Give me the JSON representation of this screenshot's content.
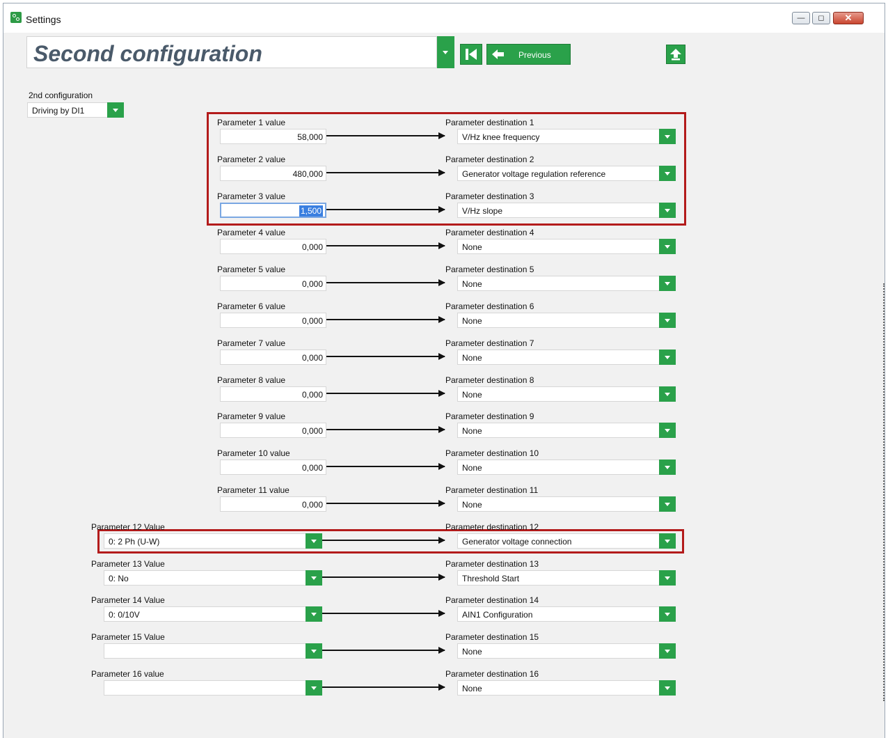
{
  "window": {
    "title": "Settings"
  },
  "header": {
    "title": "Second configuration",
    "previous_label": "Previous"
  },
  "config": {
    "label": "2nd configuration",
    "value": "Driving by DI1"
  },
  "params": [
    {
      "label": "Parameter 1 value",
      "value": "58,000",
      "dest_label": "Parameter destination 1",
      "dest": "V/Hz knee frequency"
    },
    {
      "label": "Parameter 2 value",
      "value": "480,000",
      "dest_label": "Parameter destination 2",
      "dest": "Generator voltage regulation reference"
    },
    {
      "label": "Parameter 3 value",
      "value": "1,500",
      "dest_label": "Parameter destination 3",
      "dest": "V/Hz slope"
    },
    {
      "label": "Parameter 4 value",
      "value": "0,000",
      "dest_label": "Parameter destination 4",
      "dest": "None"
    },
    {
      "label": "Parameter 5 value",
      "value": "0,000",
      "dest_label": "Parameter destination 5",
      "dest": "None"
    },
    {
      "label": "Parameter 6 value",
      "value": "0,000",
      "dest_label": "Parameter destination 6",
      "dest": "None"
    },
    {
      "label": "Parameter 7 value",
      "value": "0,000",
      "dest_label": "Parameter destination 7",
      "dest": "None"
    },
    {
      "label": "Parameter 8 value",
      "value": "0,000",
      "dest_label": "Parameter destination 8",
      "dest": "None"
    },
    {
      "label": "Parameter 9 value",
      "value": "0,000",
      "dest_label": "Parameter destination 9",
      "dest": "None"
    },
    {
      "label": "Parameter 10 value",
      "value": "0,000",
      "dest_label": "Parameter destination 10",
      "dest": "None"
    },
    {
      "label": "Parameter 11 value",
      "value": "0,000",
      "dest_label": "Parameter destination 11",
      "dest": "None"
    },
    {
      "label": "Parameter 12 Value",
      "value": "0: 2 Ph (U-W)",
      "dest_label": "Parameter destination 12",
      "dest": "Generator voltage connection"
    },
    {
      "label": "Parameter 13 Value",
      "value": "0: No",
      "dest_label": "Parameter destination 13",
      "dest": "Threshold Start"
    },
    {
      "label": "Parameter 14 Value",
      "value": "0: 0/10V",
      "dest_label": "Parameter destination 14",
      "dest": "AIN1 Configuration"
    },
    {
      "label": "Parameter 15 Value",
      "value": "",
      "dest_label": "Parameter destination 15",
      "dest": "None"
    },
    {
      "label": "Parameter 16 value",
      "value": "",
      "dest_label": "Parameter destination 16",
      "dest": "None"
    }
  ],
  "colors": {
    "accent_green": "#2aa14a",
    "highlight_red": "#b31b1b",
    "title_gray": "#4a5a6a"
  },
  "icons": {
    "app": "settings-gears-icon",
    "first": "skip-to-first-icon",
    "prev": "arrow-left-icon",
    "upload": "upload-arrow-icon"
  }
}
